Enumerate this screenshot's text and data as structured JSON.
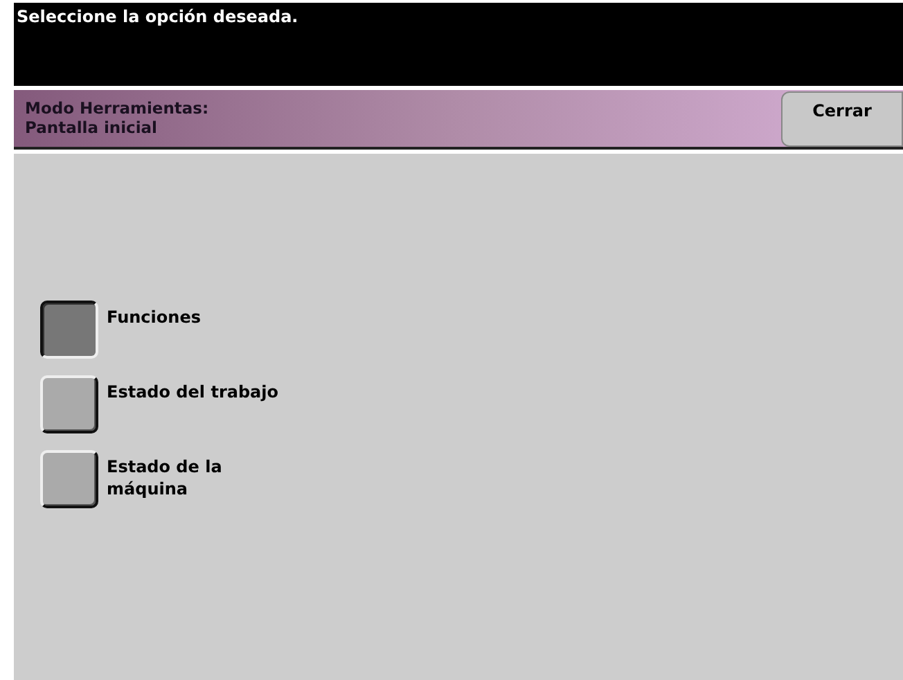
{
  "message": "Seleccione la opción deseada.",
  "header": {
    "title_lines": [
      "Modo Herramientas:",
      "Pantalla inicial"
    ],
    "close_button": "Cerrar"
  },
  "options": [
    {
      "label_lines": [
        "Funciones"
      ],
      "selected": true
    },
    {
      "label_lines": [
        "Estado del trabajo"
      ],
      "selected": false
    },
    {
      "label_lines": [
        "Estado de la",
        "máquina"
      ],
      "selected": false
    }
  ]
}
